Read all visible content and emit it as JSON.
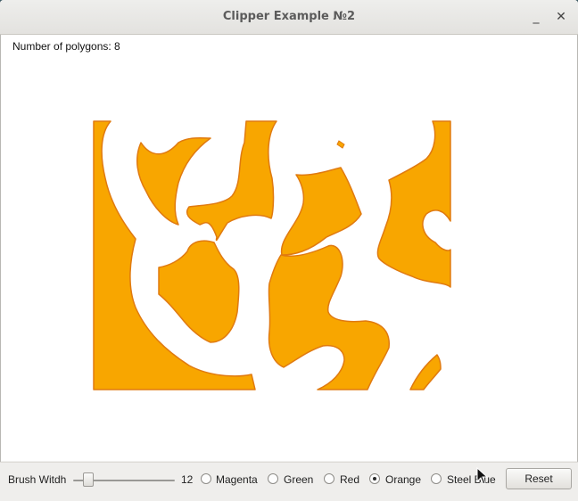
{
  "window": {
    "title": "Clipper Example №2",
    "minimize_glyph": "_",
    "close_glyph": "✕"
  },
  "status": {
    "polygon_count": "Number of polygons: 8"
  },
  "drawing": {
    "fill_color": "#f8a600",
    "stroke_color": "#e07a10",
    "background": "#ffffff"
  },
  "controls": {
    "brush_label": "Brush Witdh",
    "brush_value": "12",
    "colors": [
      {
        "label": "Magenta",
        "checked": false
      },
      {
        "label": "Green",
        "checked": false
      },
      {
        "label": "Red",
        "checked": false
      },
      {
        "label": "Orange",
        "checked": true
      },
      {
        "label": "Steel Blue",
        "checked": false
      }
    ],
    "reset_label": "Reset"
  }
}
